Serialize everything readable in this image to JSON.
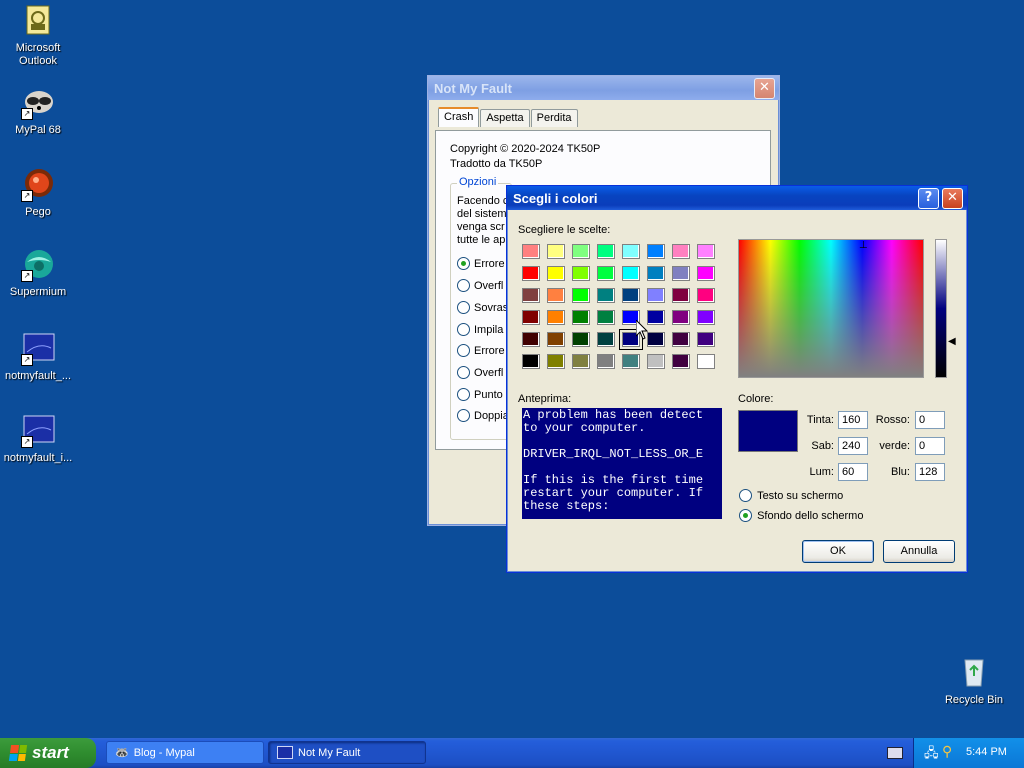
{
  "desktop": {
    "icons": [
      {
        "label": "Microsoft Outlook",
        "icon": "outlook-icon"
      },
      {
        "label": "MyPal 68",
        "icon": "mypal-icon"
      },
      {
        "label": "Pego",
        "icon": "pego-icon"
      },
      {
        "label": "Supermium",
        "icon": "supermium-icon"
      },
      {
        "label": "notmyfault_...",
        "icon": "notmyfault-icon"
      },
      {
        "label": "notmyfault_i...",
        "icon": "notmyfault-icon"
      },
      {
        "label": "Recycle Bin",
        "icon": "recycle-bin-icon"
      }
    ]
  },
  "main_window": {
    "title": "Not My Fault",
    "tabs": [
      {
        "label": "Crash"
      },
      {
        "label": "Aspetta"
      },
      {
        "label": "Perdita"
      }
    ],
    "copyright": "Copyright © 2020-2024 TK50P",
    "translated_by": "Tradotto da TK50P",
    "options_legend": "Opzioni",
    "description_lines": [
      "Facendo c",
      "del sistem",
      "venga scr",
      "tutte le ap"
    ],
    "options": [
      {
        "label": "Errore",
        "selected": true
      },
      {
        "label": "Overfl",
        "selected": false
      },
      {
        "label": "Sovras",
        "selected": false
      },
      {
        "label": "Impila",
        "selected": false
      },
      {
        "label": "Errore",
        "selected": false
      },
      {
        "label": "Overfl",
        "selected": false
      },
      {
        "label": "Punto",
        "selected": false
      },
      {
        "label": "Doppia",
        "selected": false
      }
    ]
  },
  "color_dialog": {
    "title": "Scegli i colori",
    "help_symbol": "?",
    "close_symbol": "✕",
    "choices_label": "Scegliere le scelte:",
    "swatches": [
      [
        "#ff8080",
        "#ffff80",
        "#80ff80",
        "#00ff80",
        "#80ffff",
        "#0080ff",
        "#ff80c0",
        "#ff80ff"
      ],
      [
        "#ff0000",
        "#ffff00",
        "#80ff00",
        "#00ff40",
        "#00ffff",
        "#0080c0",
        "#8080c0",
        "#ff00ff"
      ],
      [
        "#804040",
        "#ff8040",
        "#00ff00",
        "#008080",
        "#004080",
        "#8080ff",
        "#800040",
        "#ff0080"
      ],
      [
        "#800000",
        "#ff8000",
        "#008000",
        "#008040",
        "#0000ff",
        "#0000a0",
        "#800080",
        "#8000ff"
      ],
      [
        "#400000",
        "#804000",
        "#004000",
        "#004040",
        "#000080",
        "#000040",
        "#400040",
        "#400080"
      ],
      [
        "#000000",
        "#808000",
        "#808040",
        "#808080",
        "#408080",
        "#c0c0c0",
        "#400040",
        "#ffffff"
      ]
    ],
    "selected_swatch": [
      4,
      4
    ],
    "preview_label": "Anteprima:",
    "preview_text": "A problem has been detect\nto your computer.\n\nDRIVER_IRQL_NOT_LESS_OR_E\n\nIf this is the first time\nrestart your computer. If\nthese steps:",
    "color_label": "Colore:",
    "current_color": "#000080",
    "fields": {
      "hue": {
        "label": "Tinta:",
        "value": "160"
      },
      "sat": {
        "label": "Sab:",
        "value": "240"
      },
      "lum": {
        "label": "Lum:",
        "value": "60"
      },
      "red": {
        "label": "Rosso:",
        "value": "0"
      },
      "green": {
        "label": "verde:",
        "value": "0"
      },
      "blue": {
        "label": "Blu:",
        "value": "128"
      }
    },
    "target_options": [
      {
        "label": "Testo su schermo",
        "selected": false
      },
      {
        "label": "Sfondo dello schermo",
        "selected": true
      }
    ],
    "ok_label": "OK",
    "cancel_label": "Annulla"
  },
  "taskbar": {
    "start_label": "start",
    "tasks": [
      {
        "label": "Blog - Mypal"
      },
      {
        "label": "Not My Fault"
      }
    ],
    "clock": "5:44 PM"
  }
}
